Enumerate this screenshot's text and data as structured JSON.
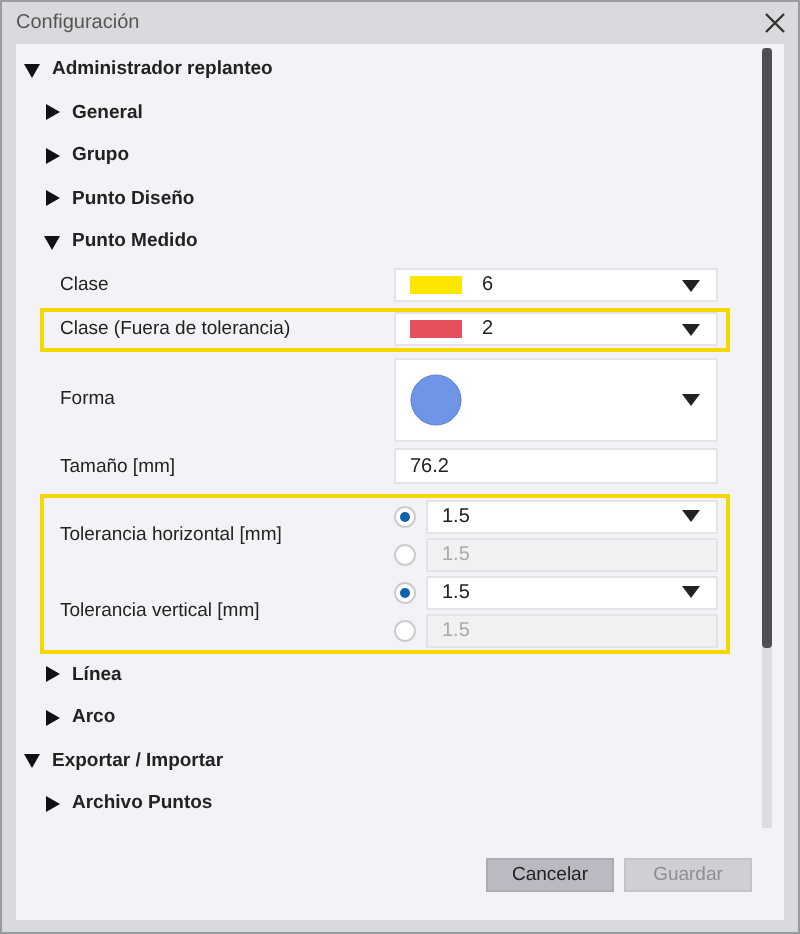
{
  "window": {
    "title": "Configuración"
  },
  "tree": [
    {
      "label": "Administrador replanteo",
      "expanded": true,
      "children": [
        {
          "label": "General",
          "expanded": false
        },
        {
          "label": "Grupo",
          "expanded": false
        },
        {
          "label": "Punto Diseño",
          "expanded": false
        },
        {
          "label": "Punto Medido",
          "expanded": true,
          "sections": [
            {
              "highlighted": false,
              "settings": [
                {
                  "kind": "color",
                  "label": "Clase",
                  "color": "#ffe600",
                  "value": "6"
                }
              ]
            },
            {
              "highlighted": true,
              "settings": [
                {
                  "kind": "color",
                  "label": "Clase (Fuera de tolerancia)",
                  "color": "#e5505a",
                  "value": "2"
                }
              ]
            },
            {
              "highlighted": false,
              "settings": [
                {
                  "kind": "shape",
                  "label": "Forma"
                },
                {
                  "kind": "text",
                  "label": "Tamaño [mm]",
                  "value": "76.2"
                }
              ]
            },
            {
              "highlighted": true,
              "settings": [
                {
                  "kind": "radio",
                  "label": "Tolerancia horizontal [mm]",
                  "options": [
                    {
                      "selected": true,
                      "value": "1.5",
                      "disabled": false
                    },
                    {
                      "selected": false,
                      "value": "1.5",
                      "disabled": true
                    }
                  ]
                },
                {
                  "kind": "radio",
                  "label": "Tolerancia vertical [mm]",
                  "options": [
                    {
                      "selected": true,
                      "value": "1.5",
                      "disabled": false
                    },
                    {
                      "selected": false,
                      "value": "1.5",
                      "disabled": true
                    }
                  ]
                }
              ]
            }
          ]
        },
        {
          "label": "Línea",
          "expanded": false
        },
        {
          "label": "Arco",
          "expanded": false
        }
      ]
    },
    {
      "label": "Exportar / Importar",
      "expanded": true,
      "children": [
        {
          "label": "Archivo Puntos",
          "expanded": false
        }
      ]
    }
  ],
  "buttons": [
    {
      "label": "Cancelar",
      "disabled": false
    },
    {
      "label": "Guardar",
      "disabled": true
    }
  ]
}
